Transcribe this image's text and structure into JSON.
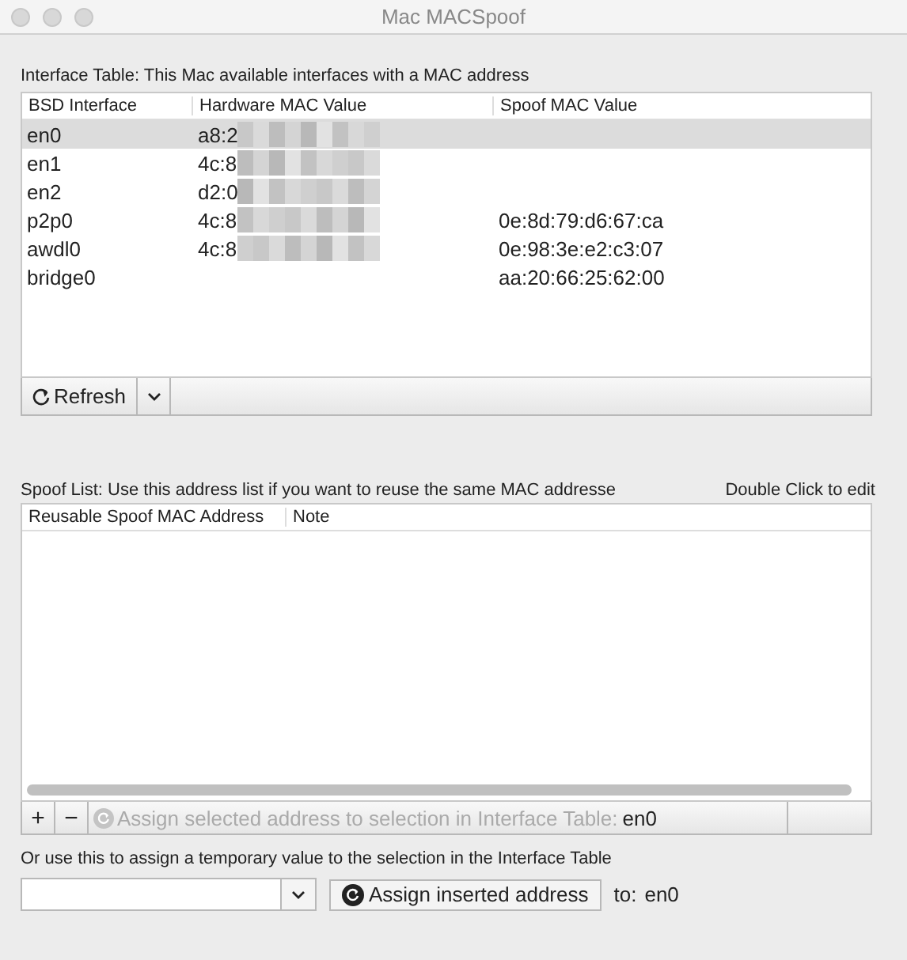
{
  "window": {
    "title": "Mac MACSpoof"
  },
  "interface_table": {
    "label": "Interface Table: This Mac available interfaces with a MAC address",
    "columns": [
      "BSD Interface",
      "Hardware MAC Value",
      "Spoof MAC Value"
    ],
    "rows": [
      {
        "interface": "en0",
        "hardware": "a8:2",
        "hardware_blurred": true,
        "spoof": "",
        "selected": true
      },
      {
        "interface": "en1",
        "hardware": "4c:8",
        "hardware_blurred": true,
        "spoof": "",
        "selected": false
      },
      {
        "interface": "en2",
        "hardware": "d2:0",
        "hardware_blurred": true,
        "spoof": "",
        "selected": false
      },
      {
        "interface": "p2p0",
        "hardware": "4c:8",
        "hardware_blurred": true,
        "spoof": "0e:8d:79:d6:67:ca",
        "selected": false
      },
      {
        "interface": "awdl0",
        "hardware": "4c:8",
        "hardware_blurred": true,
        "spoof": "0e:98:3e:e2:c3:07",
        "selected": false
      },
      {
        "interface": "bridge0",
        "hardware": "",
        "hardware_blurred": false,
        "spoof": "aa:20:66:25:62:00",
        "selected": false
      }
    ],
    "refresh_button": "Refresh"
  },
  "spoof_list": {
    "label": "Spoof List: Use this address list if you want to reuse the same MAC addresse",
    "hint": "Double Click to edit",
    "columns": [
      "Reusable Spoof MAC Address",
      "Note"
    ],
    "add_button": "+",
    "remove_button": "−",
    "assign_selected": {
      "label": "Assign selected address to selection in Interface Table:",
      "disabled": true,
      "target": "en0"
    }
  },
  "temporary": {
    "label": "Or use this to assign a temporary value to the selection in the Interface Table",
    "assign_button": "Assign inserted address",
    "to_label": "to:",
    "target": "en0"
  }
}
